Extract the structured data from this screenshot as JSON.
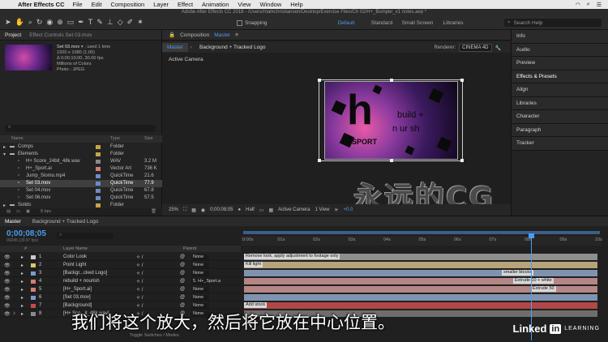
{
  "menubar": {
    "app": "After Effects CC",
    "items": [
      "File",
      "Edit",
      "Composition",
      "Layer",
      "Effect",
      "Animation",
      "View",
      "Window",
      "Help"
    ]
  },
  "window": {
    "title": "Adobe After Effects CC 2018 - /Users/markchristiansen/Desktop/Exercise Files/Ch 02/H+_Bumper_v1 notes.aep *",
    "snapping": "Snapping",
    "workspaces": [
      "Default",
      "Standard",
      "Small Screen",
      "Libraries"
    ],
    "search_placeholder": "Search Help"
  },
  "project": {
    "tabs": [
      "Project",
      "Effect Controls Set 03.mov"
    ],
    "preview": {
      "name": "Set 03.mov",
      "used": "▾ , used 1 time",
      "dims": "1920 x 1080 (1.00)",
      "duration": "Δ 0;00;10;00, 30.00 fps",
      "colors": "Millions of Colors",
      "codec": "Photo - JPEG"
    },
    "columns": {
      "name": "Name",
      "type": "Type",
      "size": "Size"
    },
    "rows": [
      {
        "name": "Comps",
        "type": "Folder",
        "size": "",
        "color": "#c9a24a",
        "indent": 0
      },
      {
        "name": "Elements",
        "type": "Folder",
        "size": "",
        "color": "#c9a24a",
        "indent": 0
      },
      {
        "name": "H+ Score_24bit_48k.wav",
        "type": "WAV",
        "size": "3.2 M",
        "color": "#8a8a8a",
        "indent": 1
      },
      {
        "name": "H+_Sport.ai",
        "type": "Vector Art",
        "size": "736 K",
        "color": "#d67b7b",
        "indent": 1
      },
      {
        "name": "Jump_Slomo.mp4",
        "type": "QuickTime",
        "size": "21.6",
        "color": "#6b8cc7",
        "indent": 1
      },
      {
        "name": "Set 03.mov",
        "type": "QuickTime",
        "size": "77.9",
        "color": "#6b8cc7",
        "indent": 1,
        "selected": true
      },
      {
        "name": "Set 04.mov",
        "type": "QuickTime",
        "size": "67.8",
        "color": "#6b8cc7",
        "indent": 1
      },
      {
        "name": "Set 06.mov",
        "type": "QuickTime",
        "size": "57.5",
        "color": "#6b8cc7",
        "indent": 1
      },
      {
        "name": "Solids",
        "type": "Folder",
        "size": "",
        "color": "#c9a24a",
        "indent": 0
      }
    ],
    "bpc": "8 bpc"
  },
  "composition": {
    "tab_label": "Composition",
    "tab_name": "Master",
    "subtabs": [
      "Master",
      "Background + Tracked Logo"
    ],
    "renderer_label": "Renderer:",
    "renderer_value": "CINEMA 4D",
    "active_camera": "Active Camera",
    "logo_h": "h",
    "logo_sport": "SPORT",
    "logo_build": "build +",
    "logo_nourish": "n ur sh",
    "watermark": "永远的CG",
    "footer": {
      "zoom": "25%",
      "timecode": "0;00;08;05",
      "resolution": "Half",
      "view": "Active Camera",
      "views": "1 View",
      "exposure": "+0.0"
    }
  },
  "rightpanels": [
    "Info",
    "Audio",
    "Preview",
    "Effects & Presets",
    "Align",
    "Libraries",
    "Character",
    "Paragraph",
    "Tracker"
  ],
  "timeline": {
    "tabs": [
      "Master",
      "Background + Tracked Logo"
    ],
    "timecode": "0;00;08;05",
    "timecode_sub": "00245 (29.97 fps)",
    "columns": {
      "num": "#",
      "layer_name": "Layer Name",
      "parent": "Parent"
    },
    "ruler": [
      "0:00s",
      "01s",
      "02s",
      "03s",
      "04s",
      "05s",
      "06s",
      "07s",
      "08s",
      "09s",
      "10s"
    ],
    "layers": [
      {
        "num": "1",
        "name": "Color Look",
        "parent": "None",
        "color": "#c9c9c9"
      },
      {
        "num": "2",
        "name": "Point Light",
        "parent": "None",
        "color": "#e0c26b"
      },
      {
        "num": "3",
        "name": "[Backgr...cked Logo]",
        "parent": "None",
        "color": "#7a9ac9"
      },
      {
        "num": "4",
        "name": "rebuild + nourish",
        "parent": "5. H+_Sport.a",
        "color": "#d67b7b"
      },
      {
        "num": "5",
        "name": "[H+_Sport.ai]",
        "parent": "None",
        "color": "#d67b7b"
      },
      {
        "num": "6",
        "name": "[Set 03.mov]",
        "parent": "None",
        "color": "#7a9ac9"
      },
      {
        "num": "7",
        "name": "[Background]",
        "parent": "None",
        "color": "#c94a4a"
      },
      {
        "num": "8",
        "name": "[H+ Sco...it_48k.wav]",
        "parent": "None",
        "color": "#8a8a8a"
      }
    ],
    "bars": [
      {
        "label": "Remove look, apply adjustment to footage only",
        "color": "#8e8e8e"
      },
      {
        "label": "Kill light",
        "color": "#b7a47a"
      },
      {
        "label": "smaller blocks",
        "color": "#7f93b0"
      },
      {
        "label": "Extrude 10 + white",
        "color": "#b48686"
      },
      {
        "label": "Extrude 50",
        "color": "#b48686"
      },
      {
        "label": "",
        "color": "#7f93b0"
      },
      {
        "label": "Add stock",
        "color": "#b04848"
      },
      {
        "label": "",
        "color": "#6e6e6e"
      }
    ],
    "toggle": "Toggle Switches / Modes"
  },
  "subtitle": "我们将这个放大，然后将它放在中心位置。",
  "brand": {
    "name": "Linked",
    "in": "in",
    "learning": "LEARNING"
  }
}
